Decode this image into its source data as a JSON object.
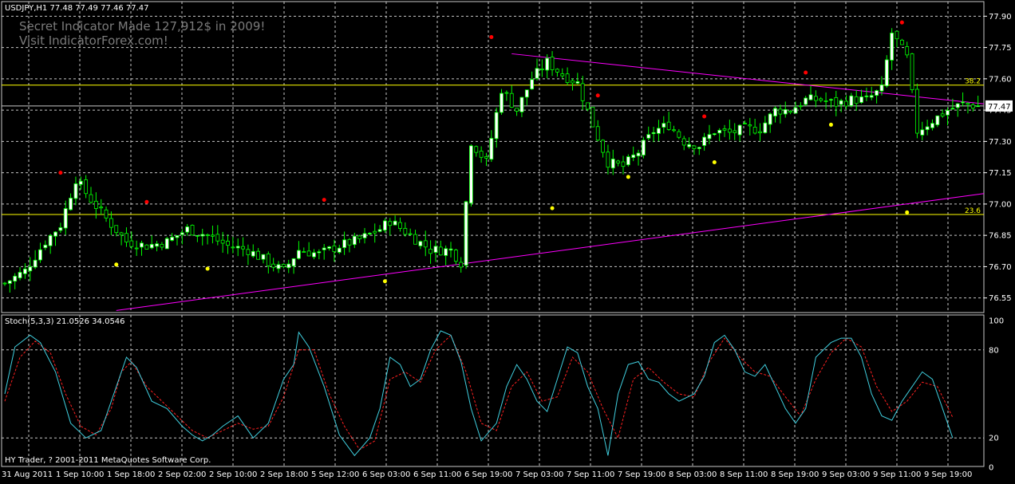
{
  "header": {
    "symbol_line": "USDJPY,H1  77.48 77.49 77.46 77.47",
    "promo_line1": "Secret Indicator Made 127,912$ in 2009!",
    "promo_line2": "Visit IndicatorForex.com!"
  },
  "footer": {
    "copyright": "HY Trader, ? 2001-2011 MetaQuotes Software Corp."
  },
  "colors": {
    "background": "#000000",
    "grid": "#c8c8c8",
    "axis_text": "#ffffff",
    "bull_body": "#ffffff",
    "bear_body": "#000000",
    "wick": "#00ff00",
    "trendline": "#ff00ff",
    "fib_line": "#ffff00",
    "fractal_up": "#ff0000",
    "fractal_down": "#ffff00",
    "stoch_main": "#40d0e0",
    "stoch_signal": "#ff2020"
  },
  "chart_data": [
    {
      "type": "candlestick",
      "title": "USDJPY,H1",
      "ylim": [
        76.48,
        77.97
      ],
      "y_ticks": [
        "77.90",
        "77.75",
        "77.60",
        "77.45",
        "77.30",
        "77.15",
        "77.00",
        "76.85",
        "76.70",
        "76.55"
      ],
      "current_price": "77.47",
      "fib_levels": [
        {
          "label": "38.2",
          "value": 77.57
        },
        {
          "label": "23.6",
          "value": 76.95
        }
      ],
      "x_labels": [
        "31 Aug 2011",
        "1 Sep 10:00",
        "1 Sep 18:00",
        "2 Sep 02:00",
        "2 Sep 10:00",
        "2 Sep 18:00",
        "5 Sep 12:00",
        "6 Sep 03:00",
        "6 Sep 11:00",
        "6 Sep 19:00",
        "7 Sep 03:00",
        "7 Sep 11:00",
        "7 Sep 19:00",
        "8 Sep 03:00",
        "8 Sep 11:00",
        "8 Sep 19:00",
        "9 Sep 03:00",
        "9 Sep 11:00",
        "9 Sep 19:00"
      ],
      "close_path": [
        [
          0,
          76.62
        ],
        [
          4,
          76.68
        ],
        [
          8,
          76.82
        ],
        [
          11,
          76.9
        ],
        [
          14,
          77.12
        ],
        [
          17,
          77.02
        ],
        [
          20,
          76.93
        ],
        [
          24,
          76.82
        ],
        [
          28,
          76.8
        ],
        [
          32,
          76.82
        ],
        [
          36,
          76.88
        ],
        [
          40,
          76.85
        ],
        [
          44,
          76.8
        ],
        [
          48,
          76.78
        ],
        [
          52,
          76.72
        ],
        [
          55,
          76.68
        ],
        [
          58,
          76.78
        ],
        [
          62,
          76.76
        ],
        [
          66,
          76.8
        ],
        [
          70,
          76.83
        ],
        [
          74,
          76.88
        ],
        [
          76,
          76.92
        ],
        [
          80,
          76.85
        ],
        [
          84,
          76.78
        ],
        [
          88,
          76.78
        ],
        [
          90,
          76.72
        ],
        [
          92,
          77.3
        ],
        [
          95,
          77.2
        ],
        [
          98,
          77.55
        ],
        [
          101,
          77.45
        ],
        [
          104,
          77.6
        ],
        [
          107,
          77.68
        ],
        [
          110,
          77.62
        ],
        [
          113,
          77.58
        ],
        [
          116,
          77.38
        ],
        [
          119,
          77.2
        ],
        [
          122,
          77.18
        ],
        [
          125,
          77.25
        ],
        [
          128,
          77.35
        ],
        [
          131,
          77.38
        ],
        [
          134,
          77.3
        ],
        [
          137,
          77.28
        ],
        [
          140,
          77.35
        ],
        [
          143,
          77.34
        ],
        [
          146,
          77.36
        ],
        [
          149,
          77.36
        ],
        [
          152,
          77.45
        ],
        [
          155,
          77.45
        ],
        [
          158,
          77.5
        ],
        [
          161,
          77.5
        ],
        [
          164,
          77.48
        ],
        [
          167,
          77.5
        ],
        [
          170,
          77.5
        ],
        [
          173,
          77.55
        ],
        [
          175,
          77.82
        ],
        [
          178,
          77.7
        ],
        [
          180,
          77.35
        ],
        [
          183,
          77.4
        ],
        [
          186,
          77.45
        ],
        [
          189,
          77.48
        ],
        [
          192,
          77.47
        ]
      ],
      "stochastic": {
        "label": "Stoch(5,3,3) 21.0526 34.0546",
        "main": 21.0526,
        "signal": 34.0546,
        "levels": [
          20,
          80
        ],
        "y_ticks": [
          "100",
          "80",
          "20",
          "0"
        ],
        "main_path": [
          [
            0,
            50
          ],
          [
            2,
            82
          ],
          [
            5,
            90
          ],
          [
            7,
            85
          ],
          [
            10,
            65
          ],
          [
            13,
            30
          ],
          [
            16,
            20
          ],
          [
            19,
            25
          ],
          [
            22,
            55
          ],
          [
            24,
            75
          ],
          [
            26,
            68
          ],
          [
            29,
            45
          ],
          [
            32,
            40
          ],
          [
            35,
            28
          ],
          [
            37,
            22
          ],
          [
            39,
            18
          ],
          [
            41,
            22
          ],
          [
            43,
            28
          ],
          [
            46,
            35
          ],
          [
            49,
            20
          ],
          [
            52,
            30
          ],
          [
            55,
            60
          ],
          [
            57,
            70
          ],
          [
            58,
            92
          ],
          [
            60,
            82
          ],
          [
            63,
            55
          ],
          [
            66,
            22
          ],
          [
            69,
            8
          ],
          [
            72,
            20
          ],
          [
            74,
            40
          ],
          [
            76,
            75
          ],
          [
            78,
            70
          ],
          [
            80,
            55
          ],
          [
            82,
            60
          ],
          [
            84,
            80
          ],
          [
            86,
            93
          ],
          [
            88,
            90
          ],
          [
            90,
            72
          ],
          [
            92,
            40
          ],
          [
            94,
            18
          ],
          [
            97,
            30
          ],
          [
            99,
            55
          ],
          [
            101,
            70
          ],
          [
            103,
            60
          ],
          [
            105,
            45
          ],
          [
            107,
            38
          ],
          [
            109,
            60
          ],
          [
            111,
            82
          ],
          [
            113,
            78
          ],
          [
            115,
            55
          ],
          [
            117,
            40
          ],
          [
            119,
            8
          ],
          [
            121,
            50
          ],
          [
            123,
            70
          ],
          [
            125,
            72
          ],
          [
            127,
            60
          ],
          [
            129,
            58
          ],
          [
            131,
            50
          ],
          [
            133,
            45
          ],
          [
            136,
            50
          ],
          [
            138,
            62
          ],
          [
            140,
            85
          ],
          [
            142,
            90
          ],
          [
            144,
            80
          ],
          [
            146,
            65
          ],
          [
            148,
            62
          ],
          [
            150,
            70
          ],
          [
            152,
            55
          ],
          [
            154,
            40
          ],
          [
            156,
            30
          ],
          [
            158,
            40
          ],
          [
            160,
            75
          ],
          [
            163,
            85
          ],
          [
            165,
            88
          ],
          [
            167,
            88
          ],
          [
            169,
            75
          ],
          [
            171,
            50
          ],
          [
            173,
            35
          ],
          [
            175,
            32
          ],
          [
            177,
            45
          ],
          [
            179,
            55
          ],
          [
            181,
            65
          ],
          [
            183,
            60
          ],
          [
            185,
            40
          ],
          [
            187,
            20
          ]
        ],
        "signal_path": [
          [
            0,
            45
          ],
          [
            3,
            75
          ],
          [
            6,
            86
          ],
          [
            9,
            78
          ],
          [
            12,
            50
          ],
          [
            15,
            28
          ],
          [
            18,
            22
          ],
          [
            21,
            40
          ],
          [
            23,
            65
          ],
          [
            25,
            72
          ],
          [
            28,
            55
          ],
          [
            31,
            45
          ],
          [
            34,
            35
          ],
          [
            37,
            25
          ],
          [
            40,
            20
          ],
          [
            43,
            25
          ],
          [
            46,
            30
          ],
          [
            49,
            26
          ],
          [
            52,
            28
          ],
          [
            55,
            48
          ],
          [
            58,
            80
          ],
          [
            61,
            80
          ],
          [
            64,
            50
          ],
          [
            67,
            28
          ],
          [
            70,
            12
          ],
          [
            73,
            18
          ],
          [
            76,
            60
          ],
          [
            79,
            65
          ],
          [
            82,
            58
          ],
          [
            85,
            80
          ],
          [
            88,
            90
          ],
          [
            91,
            65
          ],
          [
            94,
            30
          ],
          [
            97,
            25
          ],
          [
            100,
            55
          ],
          [
            103,
            65
          ],
          [
            106,
            45
          ],
          [
            109,
            48
          ],
          [
            112,
            75
          ],
          [
            115,
            65
          ],
          [
            118,
            40
          ],
          [
            121,
            20
          ],
          [
            124,
            60
          ],
          [
            127,
            68
          ],
          [
            130,
            58
          ],
          [
            133,
            50
          ],
          [
            136,
            48
          ],
          [
            139,
            72
          ],
          [
            142,
            88
          ],
          [
            145,
            75
          ],
          [
            148,
            65
          ],
          [
            151,
            62
          ],
          [
            154,
            48
          ],
          [
            157,
            35
          ],
          [
            160,
            60
          ],
          [
            163,
            78
          ],
          [
            166,
            88
          ],
          [
            169,
            82
          ],
          [
            172,
            55
          ],
          [
            175,
            38
          ],
          [
            178,
            45
          ],
          [
            181,
            58
          ],
          [
            184,
            55
          ],
          [
            187,
            34
          ]
        ]
      }
    }
  ]
}
